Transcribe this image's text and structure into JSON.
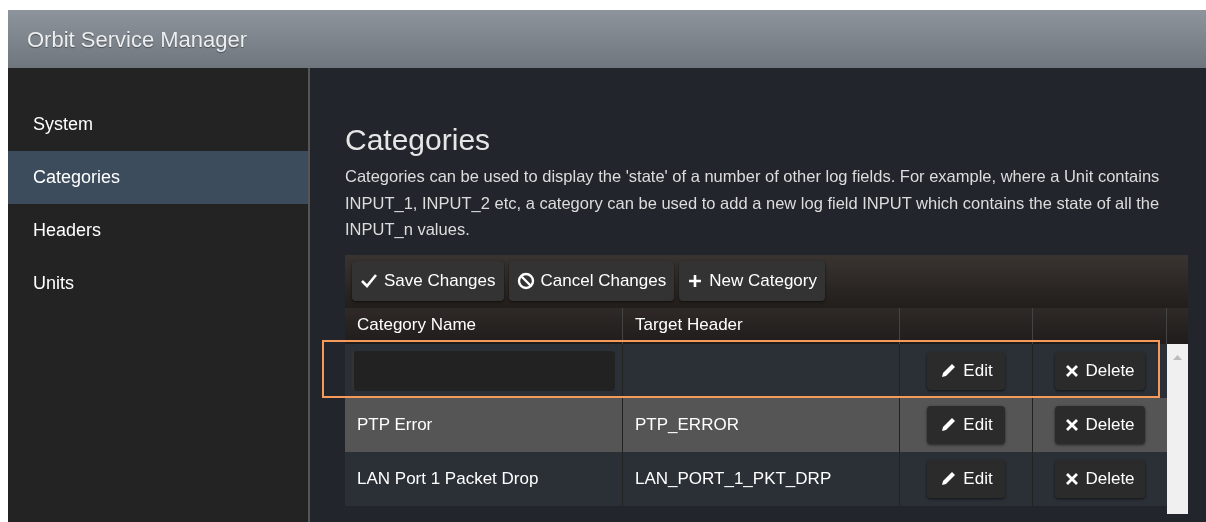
{
  "app": {
    "title": "Orbit Service Manager"
  },
  "sidebar": {
    "items": [
      {
        "label": "System",
        "selected": false
      },
      {
        "label": "Categories",
        "selected": true
      },
      {
        "label": "Headers",
        "selected": false
      },
      {
        "label": "Units",
        "selected": false
      }
    ]
  },
  "page": {
    "title": "Categories",
    "description": "Categories can be used to display the 'state' of a number of other log fields. For example, where a Unit contains INPUT_1, INPUT_2 etc, a category can be used to add a new log field INPUT which contains the state of all the INPUT_n values."
  },
  "toolbar": [
    {
      "kind": "save",
      "label": "Save Changes"
    },
    {
      "kind": "cancel",
      "label": "Cancel Changes"
    },
    {
      "kind": "new",
      "label": "New Category"
    }
  ],
  "table": {
    "columns": [
      "Category Name",
      "Target Header"
    ],
    "rows": [
      {
        "kind": "input",
        "highlighted": true,
        "edit": "Edit",
        "delete": "Delete"
      },
      {
        "kind": "text",
        "highlighted": false,
        "name": "PTP Error",
        "target": "PTP_ERROR",
        "edit": "Edit",
        "delete": "Delete"
      },
      {
        "kind": "text",
        "highlighted": false,
        "name": "LAN Port 1 Packet Drop",
        "target": "LAN_PORT_1_PKT_DRP",
        "edit": "Edit",
        "delete": "Delete"
      }
    ]
  }
}
